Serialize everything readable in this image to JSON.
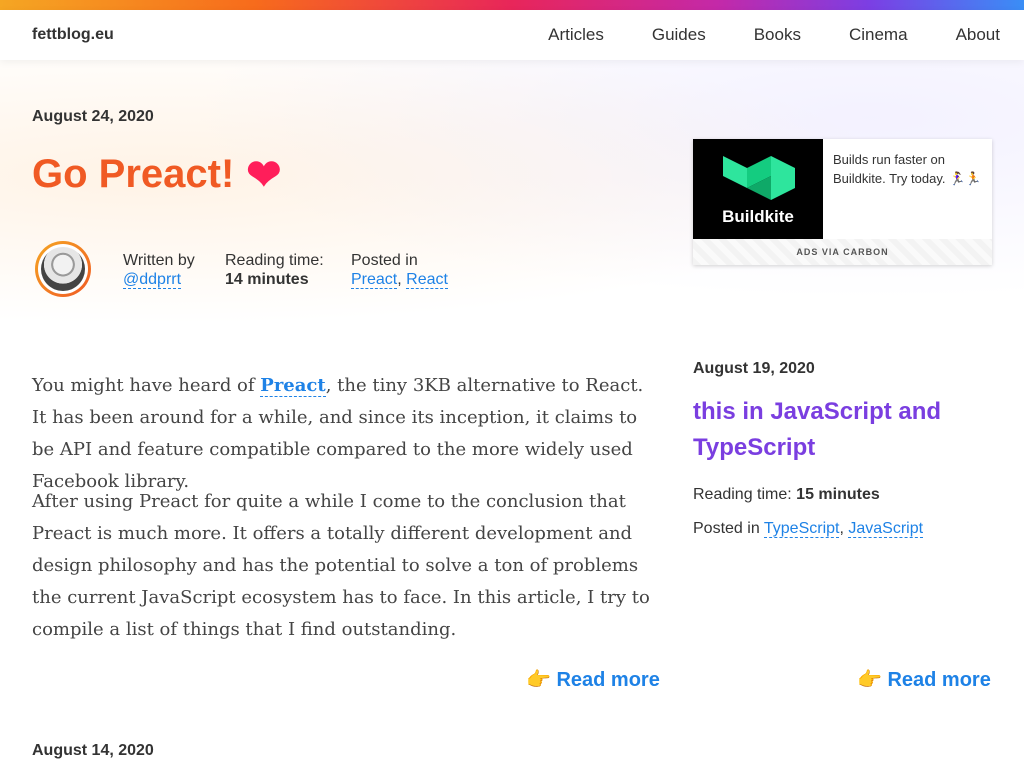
{
  "colors": {
    "accent_link": "#1e82e6",
    "title_orange": "#f05a24",
    "heart": "#ff1e5a",
    "side_title_purple": "#7a3ee0",
    "buildkite_green": "#2ee59d"
  },
  "header": {
    "brand": "fettblog.eu",
    "nav": [
      "Articles",
      "Guides",
      "Books",
      "Cinema",
      "About"
    ]
  },
  "featured": {
    "date": "August 24, 2020",
    "title": "Go Preact!",
    "title_icon": "heart-icon",
    "author_label": "Written by",
    "author": "@ddprrt",
    "reading_label": "Reading time:",
    "reading_time": "14 minutes",
    "posted_label": "Posted in",
    "categories": [
      "Preact",
      "React"
    ],
    "p1_before": "You might have heard of ",
    "p1_link": "Preact",
    "p1_after": ", the tiny 3KB alternative to React. It has been around for a while, and since its inception, it claims to be API and feature compatible compared to the more widely used Facebook library.",
    "p2": "After using Preact for quite a while I come to the conclusion that Preact is much more. It offers a totally different development and design philosophy and has the potential to solve a ton of problems the current JavaScript ecosystem has to face. In this article, I try to compile a list of things that I find outstanding.",
    "read_more": "Read more",
    "read_more_icon": "pointing-hand-icon"
  },
  "ad": {
    "logo_text": "Buildkite",
    "text": "Builds run faster on Buildkite. Try today. 🏃‍♀️🏃",
    "footer": "ADS VIA CARBON"
  },
  "side_post": {
    "date": "August 19, 2020",
    "title": "this in JavaScript and TypeScript",
    "reading_label": "Reading time:",
    "reading_time": "15 minutes",
    "posted_label": "Posted in",
    "categories": [
      "TypeScript",
      "JavaScript"
    ],
    "read_more": "Read more"
  },
  "next_post": {
    "date": "August 14, 2020"
  }
}
